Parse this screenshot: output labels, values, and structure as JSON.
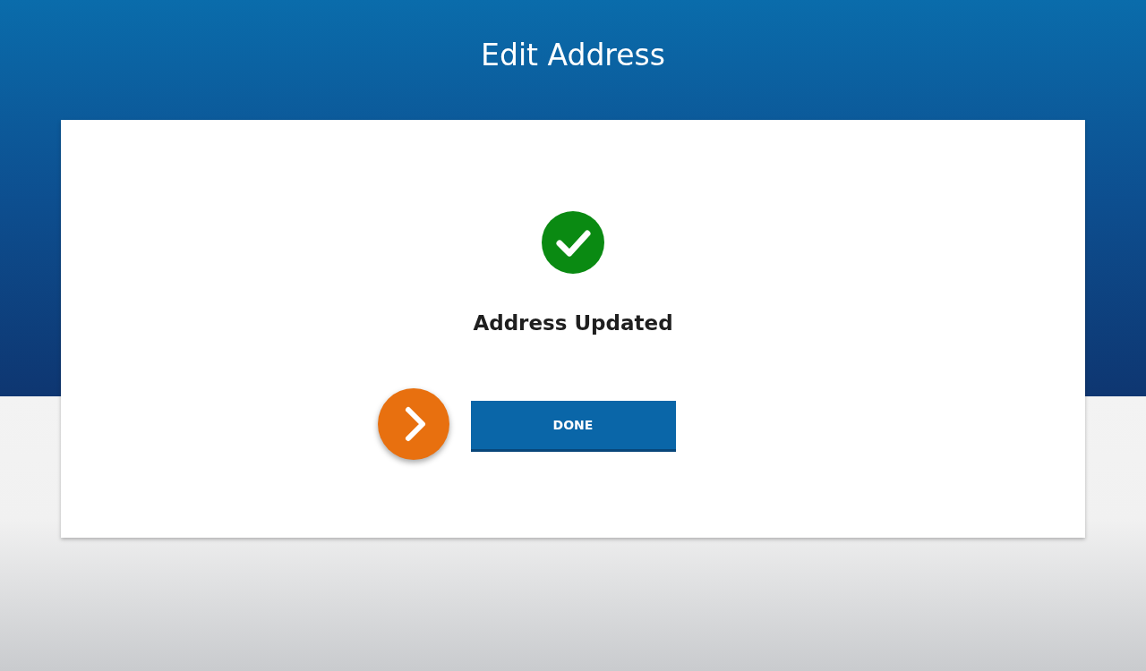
{
  "header": {
    "title": "Edit Address"
  },
  "card": {
    "success": true,
    "message": "Address Updated",
    "button": "DONE"
  }
}
